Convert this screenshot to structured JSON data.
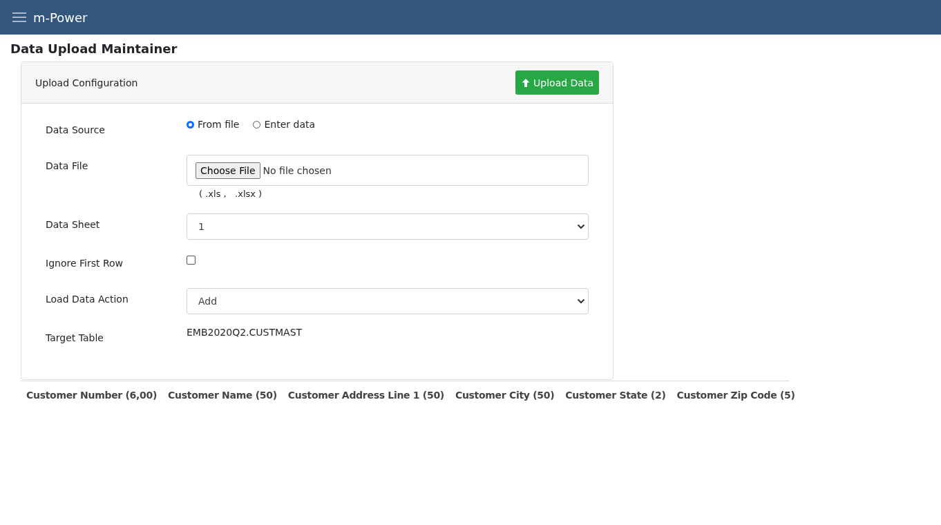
{
  "app": {
    "title": "m-Power"
  },
  "page_title": "Data Upload Maintainer",
  "card": {
    "title": "Upload Configuration",
    "upload_button": "Upload Data"
  },
  "fields": [
    {
      "kind": "radio",
      "label": "Data Source",
      "options": [
        {
          "label": "From file",
          "selected": true
        },
        {
          "label": "Enter data",
          "selected": false
        }
      ]
    },
    {
      "kind": "file",
      "label": "Data File",
      "button": "Choose File",
      "status": "No file chosen",
      "hint": "( .xls ,   .xlsx )"
    },
    {
      "kind": "select",
      "label": "Data Sheet",
      "value": "1"
    },
    {
      "kind": "checkbox",
      "label": "Ignore First Row",
      "checked": false
    },
    {
      "kind": "select",
      "label": "Load Data Action",
      "value": "Add"
    },
    {
      "kind": "text",
      "label": "Target Table",
      "value": "EMB2020Q2.CUSTMAST"
    }
  ],
  "table": {
    "columns": [
      "Customer Number (6,00)",
      "Customer Name (50)",
      "Customer Address Line 1 (50)",
      "Customer City (50)",
      "Customer State (2)",
      "Customer Zip Code (5)"
    ]
  }
}
